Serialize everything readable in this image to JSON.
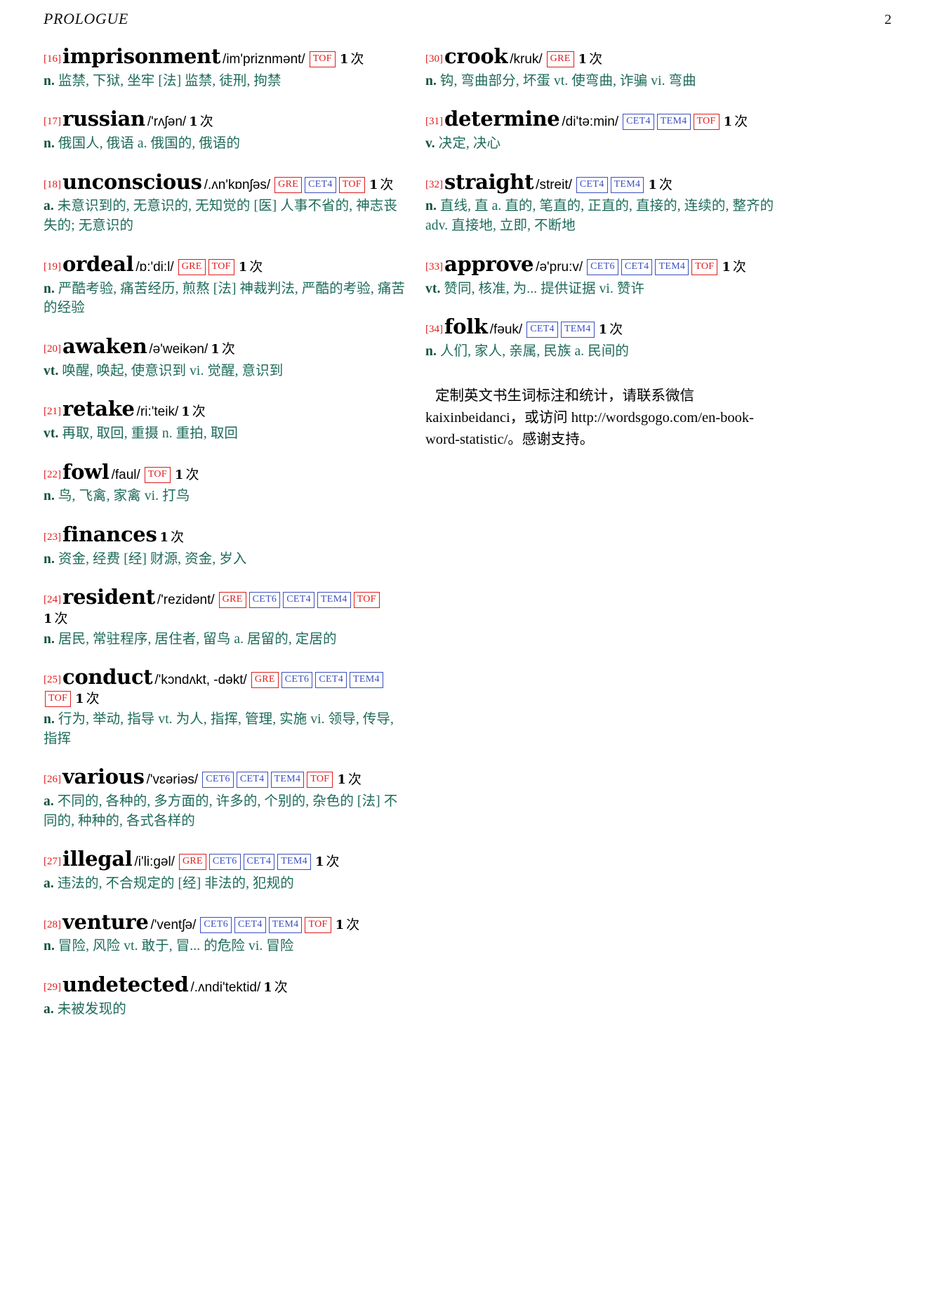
{
  "header": {
    "title": "PROLOGUE",
    "page_number": "2"
  },
  "labels": {
    "count_unit": "次"
  },
  "left_column": [
    {
      "index": "[16]",
      "word": "imprisonment",
      "phonetic": "/im'priznmənt/",
      "tags": [
        {
          "label": "TOF",
          "color": "red"
        }
      ],
      "count": "1",
      "unit": "次",
      "definition": "n. 监禁, 下狱, 坐牢 [法] 监禁, 徒刑, 拘禁"
    },
    {
      "index": "[17]",
      "word": "russian",
      "phonetic": "/'rʌʃən/",
      "tags": [],
      "count": "1",
      "unit": "次",
      "definition": "n. 俄国人, 俄语 a. 俄国的, 俄语的"
    },
    {
      "index": "[18]",
      "word": "unconscious",
      "phonetic": "/.ʌn'kɒnʃəs/",
      "tags": [
        {
          "label": "GRE",
          "color": "red"
        },
        {
          "label": "CET4",
          "color": "blue"
        },
        {
          "label": "TOF",
          "color": "red"
        }
      ],
      "count": "1",
      "unit": "次",
      "definition": "a. 未意识到的, 无意识的, 无知觉的 [医] 人事不省的, 神志丧失的; 无意识的"
    },
    {
      "index": "[19]",
      "word": "ordeal",
      "phonetic": "/ɒ:'di:l/",
      "tags": [
        {
          "label": "GRE",
          "color": "red"
        },
        {
          "label": "TOF",
          "color": "red"
        }
      ],
      "count": "1",
      "unit": "次",
      "definition": "n. 严酷考验, 痛苦经历, 煎熬 [法] 神裁判法, 严酷的考验, 痛苦的经验"
    },
    {
      "index": "[20]",
      "word": "awaken",
      "phonetic": "/ə'weikən/",
      "tags": [],
      "count": "1",
      "unit": "次",
      "definition": "vt. 唤醒, 唤起, 使意识到 vi. 觉醒, 意识到"
    },
    {
      "index": "[21]",
      "word": "retake",
      "phonetic": "/ri:'teik/",
      "tags": [],
      "count": "1",
      "unit": "次",
      "definition": "vt. 再取, 取回, 重摄 n. 重拍, 取回"
    },
    {
      "index": "[22]",
      "word": "fowl",
      "phonetic": "/faul/",
      "tags": [
        {
          "label": "TOF",
          "color": "red"
        }
      ],
      "count": "1",
      "unit": "次",
      "definition": "n. 鸟, 飞禽, 家禽 vi. 打鸟"
    },
    {
      "index": "[23]",
      "word": "finances",
      "phonetic": "",
      "tags": [],
      "count": "1",
      "unit": "次",
      "definition": "n. 资金, 经费 [经] 财源, 资金, 岁入"
    },
    {
      "index": "[24]",
      "word": "resident",
      "phonetic": "/'rezidənt/",
      "tags": [
        {
          "label": "GRE",
          "color": "red"
        },
        {
          "label": "CET6",
          "color": "blue"
        },
        {
          "label": "CET4",
          "color": "blue"
        },
        {
          "label": "TEM4",
          "color": "blue"
        },
        {
          "label": "TOF",
          "color": "red"
        }
      ],
      "count": "1",
      "unit": "次",
      "definition": "n. 居民, 常驻程序, 居住者, 留鸟 a. 居留的, 定居的"
    },
    {
      "index": "[25]",
      "word": "conduct",
      "phonetic": "/'kɔndʌkt, -dəkt/",
      "tags": [
        {
          "label": "GRE",
          "color": "red"
        },
        {
          "label": "CET6",
          "color": "blue"
        },
        {
          "label": "CET4",
          "color": "blue"
        },
        {
          "label": "TEM4",
          "color": "blue"
        },
        {
          "label": "TOF",
          "color": "red"
        }
      ],
      "count": "1",
      "unit": "次",
      "definition": "n. 行为, 举动, 指导 vt. 为人, 指挥, 管理, 实施 vi. 领导, 传导, 指挥"
    },
    {
      "index": "[26]",
      "word": "various",
      "phonetic": "/'vɛəriəs/",
      "tags": [
        {
          "label": "CET6",
          "color": "blue"
        },
        {
          "label": "CET4",
          "color": "blue"
        },
        {
          "label": "TEM4",
          "color": "blue"
        },
        {
          "label": "TOF",
          "color": "red"
        }
      ],
      "count": "1",
      "unit": "次",
      "definition": "a. 不同的, 各种的, 多方面的, 许多的, 个别的, 杂色的 [法] 不同的, 种种的, 各式各样的"
    },
    {
      "index": "[27]",
      "word": "illegal",
      "phonetic": "/i'li:gəl/",
      "tags": [
        {
          "label": "GRE",
          "color": "red"
        },
        {
          "label": "CET6",
          "color": "blue"
        },
        {
          "label": "CET4",
          "color": "blue"
        },
        {
          "label": "TEM4",
          "color": "blue"
        }
      ],
      "count": "1",
      "unit": "次",
      "definition": "a. 违法的, 不合规定的 [经] 非法的, 犯规的"
    },
    {
      "index": "[28]",
      "word": "venture",
      "phonetic": "/'ventʃə/",
      "tags": [
        {
          "label": "CET6",
          "color": "blue"
        },
        {
          "label": "CET4",
          "color": "blue"
        },
        {
          "label": "TEM4",
          "color": "blue"
        },
        {
          "label": "TOF",
          "color": "red"
        }
      ],
      "count": "1",
      "unit": "次",
      "definition": "n. 冒险, 风险 vt. 敢于, 冒... 的危险 vi. 冒险"
    },
    {
      "index": "[29]",
      "word": "undetected",
      "phonetic": "/.ʌndi'tektid/",
      "tags": [],
      "count": "1",
      "unit": "次",
      "definition": "a. 未被发现的"
    }
  ],
  "right_column": [
    {
      "index": "[30]",
      "word": "crook",
      "phonetic": "/kruk/",
      "tags": [
        {
          "label": "GRE",
          "color": "red"
        }
      ],
      "count": "1",
      "unit": "次",
      "definition": "n. 钩, 弯曲部分, 坏蛋 vt. 使弯曲, 诈骗 vi. 弯曲"
    },
    {
      "index": "[31]",
      "word": "determine",
      "phonetic": "/di'tə:min/",
      "tags": [
        {
          "label": "CET4",
          "color": "blue"
        },
        {
          "label": "TEM4",
          "color": "blue"
        },
        {
          "label": "TOF",
          "color": "red"
        }
      ],
      "count": "1",
      "unit": "次",
      "definition": "v. 决定, 决心"
    },
    {
      "index": "[32]",
      "word": "straight",
      "phonetic": "/streit/",
      "tags": [
        {
          "label": "CET4",
          "color": "blue"
        },
        {
          "label": "TEM4",
          "color": "blue"
        }
      ],
      "count": "1",
      "unit": "次",
      "definition": "n. 直线, 直 a. 直的, 笔直的, 正直的, 直接的, 连续的, 整齐的 adv. 直接地, 立即, 不断地"
    },
    {
      "index": "[33]",
      "word": "approve",
      "phonetic": "/ə'pru:v/",
      "tags": [
        {
          "label": "CET6",
          "color": "blue"
        },
        {
          "label": "CET4",
          "color": "blue"
        },
        {
          "label": "TEM4",
          "color": "blue"
        },
        {
          "label": "TOF",
          "color": "red"
        }
      ],
      "count": "1",
      "unit": "次",
      "definition": "vt. 赞同, 核准, 为... 提供证据 vi. 赞许"
    },
    {
      "index": "[34]",
      "word": "folk",
      "phonetic": "/fəuk/",
      "tags": [
        {
          "label": "CET4",
          "color": "blue"
        },
        {
          "label": "TEM4",
          "color": "blue"
        }
      ],
      "count": "1",
      "unit": "次",
      "definition": "n. 人们, 家人, 亲属, 民族 a. 民间的"
    }
  ],
  "promo": {
    "text": "定制英文书生词标注和统计，请联系微信 kaixinbeidanci，或访问 http://wordsgogo.com/en-book-word-statistic/。感谢支持。"
  }
}
